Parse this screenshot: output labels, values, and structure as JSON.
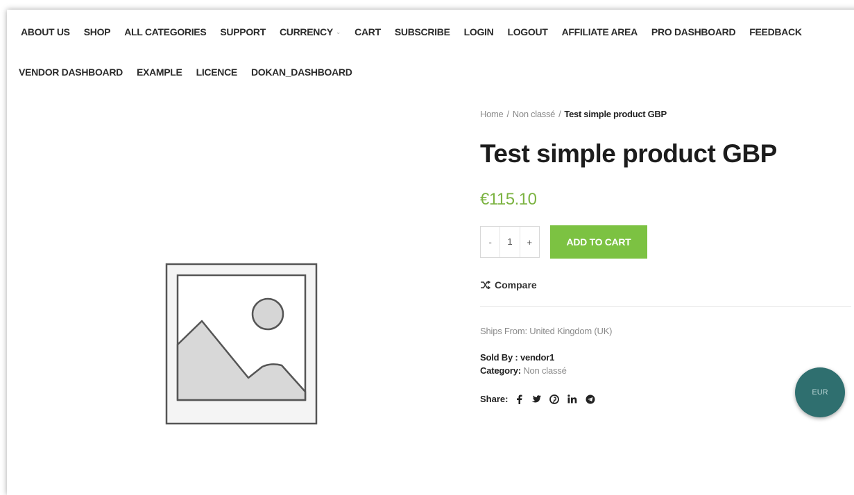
{
  "nav": {
    "row1": [
      "ABOUT US",
      "SHOP",
      "ALL CATEGORIES",
      "SUPPORT",
      "CURRENCY",
      "CART",
      "SUBSCRIBE",
      "LOGIN",
      "LOGOUT",
      "AFFILIATE AREA",
      "PRO DASHBOARD",
      "FEEDBACK"
    ],
    "row2": [
      "VENDOR DASHBOARD",
      "EXAMPLE",
      "LICENCE",
      "DOKAN_DASHBOARD"
    ]
  },
  "breadcrumb": {
    "home": "Home",
    "sep": "/",
    "category": "Non classé",
    "current": "Test simple product GBP"
  },
  "product": {
    "title": "Test simple product GBP",
    "price": "€115.10",
    "qty_minus": "-",
    "qty_value": "1",
    "qty_plus": "+",
    "add_to_cart": "ADD TO CART",
    "compare": "Compare",
    "ships_from": "Ships From: United Kingdom (UK)",
    "sold_by_label": "Sold By :",
    "sold_by_value": "vendor1",
    "category_label": "Category:",
    "category_value": "Non classé",
    "share_label": "Share:"
  },
  "share_icons": [
    "facebook-icon",
    "twitter-icon",
    "pinterest-icon",
    "linkedin-icon",
    "telegram-icon"
  ],
  "currency_switcher": "EUR",
  "colors": {
    "accent_green": "#7cc242",
    "price_green": "#7cb342",
    "currency_bubble": "#2f6f6f"
  }
}
